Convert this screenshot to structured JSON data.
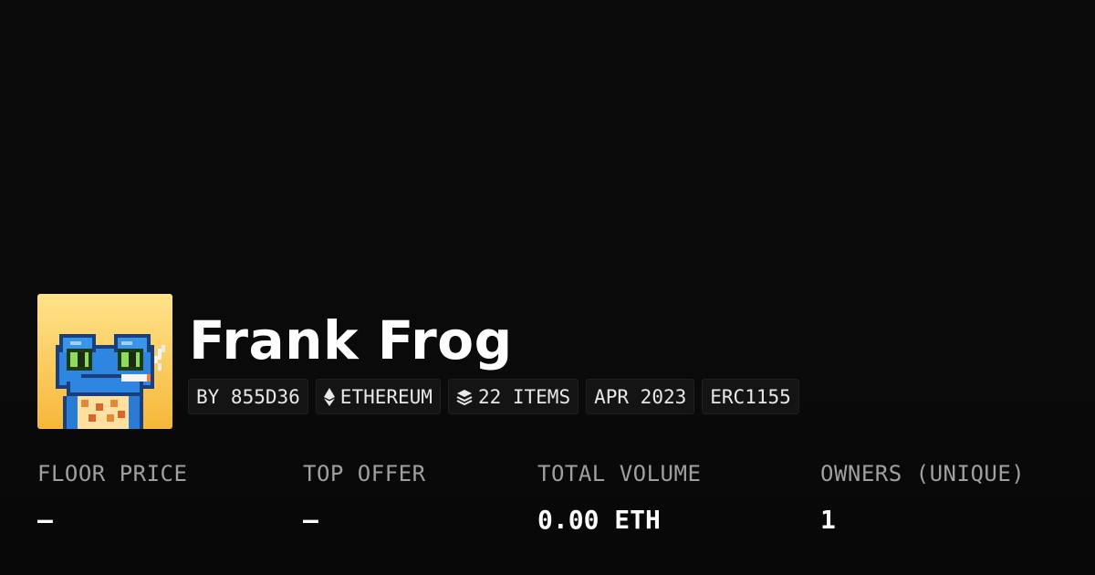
{
  "collection": {
    "name": "Frank Frog",
    "avatar_icon": "frog-avatar-icon",
    "tags": [
      {
        "label": "BY 855D36",
        "icon": null
      },
      {
        "label": "ETHEREUM",
        "icon": "ethereum-icon"
      },
      {
        "label": "22 ITEMS",
        "icon": "layers-icon"
      },
      {
        "label": "APR 2023",
        "icon": null
      },
      {
        "label": "ERC1155",
        "icon": null
      }
    ]
  },
  "stats": [
    {
      "label": "FLOOR PRICE",
      "value": "–"
    },
    {
      "label": "TOP OFFER",
      "value": "–"
    },
    {
      "label": "TOTAL VOLUME",
      "value": "0.00 ETH"
    },
    {
      "label": "OWNERS (UNIQUE)",
      "value": "1"
    }
  ],
  "colors": {
    "background": "#0b0b0b",
    "text_primary": "#ffffff",
    "text_secondary": "#a0a0a0",
    "tag_background": "#141414"
  }
}
